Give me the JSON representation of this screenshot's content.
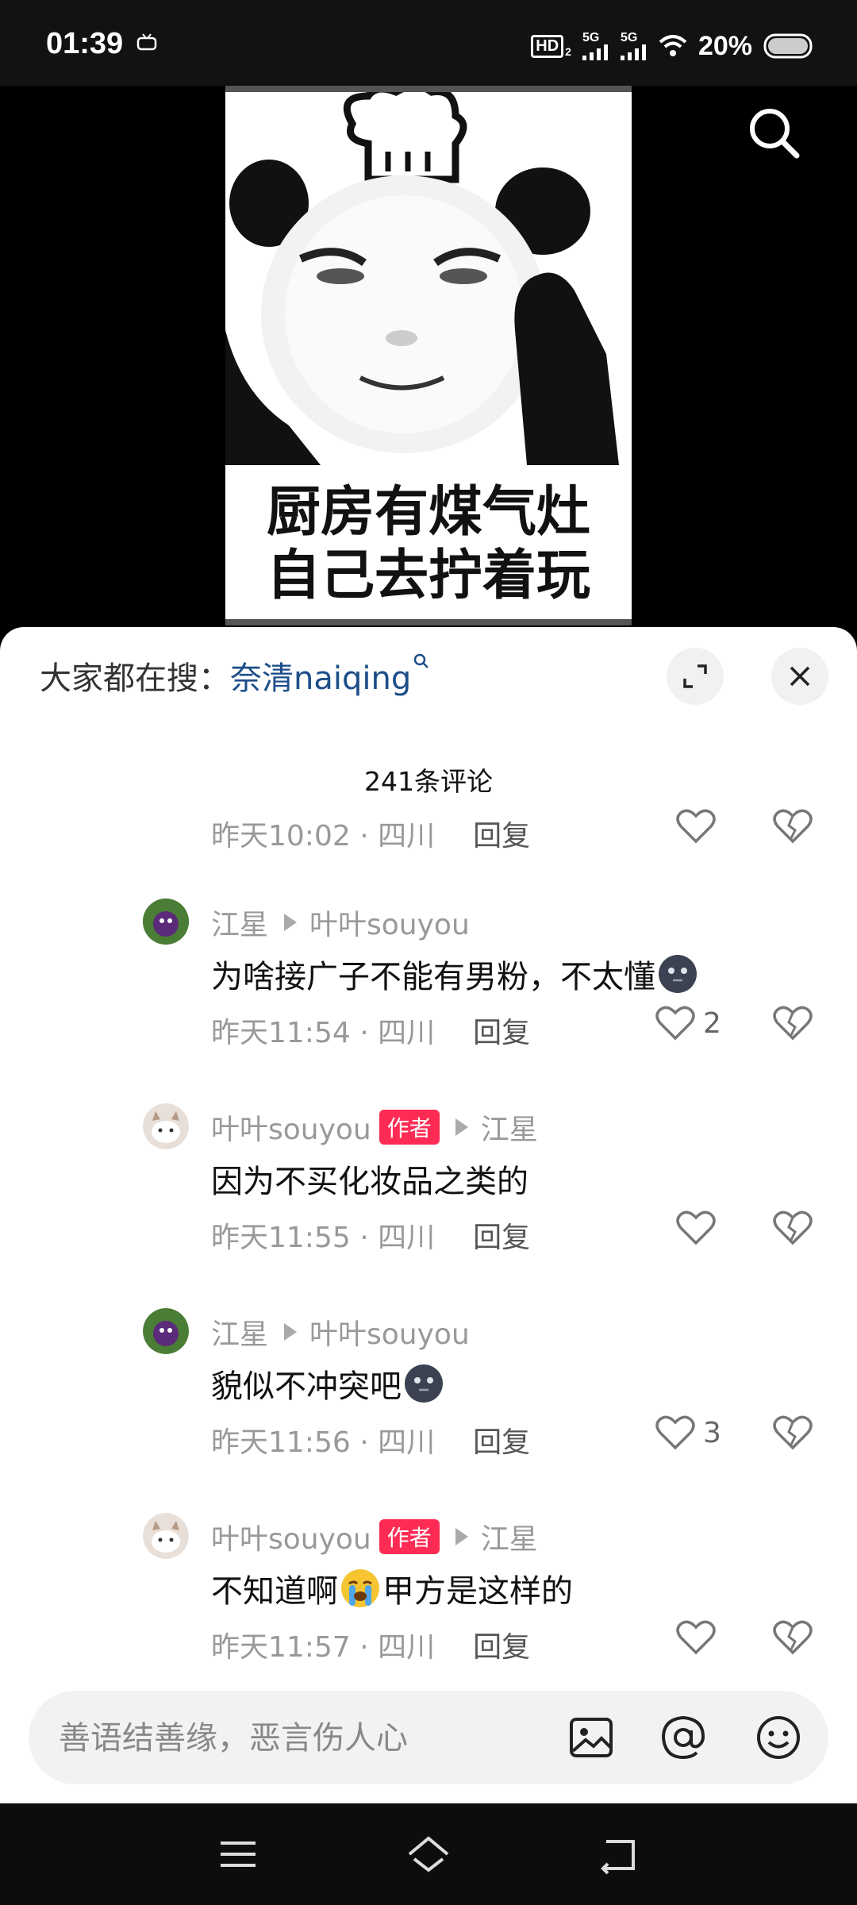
{
  "status_bar": {
    "time": "01:39",
    "hd_label": "HD",
    "hd_sub": "2",
    "sim1": "5G",
    "sim2": "5G",
    "battery": "20%"
  },
  "video": {
    "caption_line1": "厨房有煤气灶",
    "caption_line2": "自己去拧着玩"
  },
  "comments_panel": {
    "search_prefix": "大家都在搜：",
    "search_keyword": "奈清naiqing",
    "count_label": "241条评论",
    "comments": [
      {
        "kind": "partial",
        "time": "昨天10:02 · 四川",
        "reply_label": "回复",
        "likes": ""
      },
      {
        "author": "江星",
        "is_author": false,
        "reply_to": "叶叶souyou",
        "text": "为啥接广子不能有男粉，不太懂",
        "emoji": "dark-face",
        "time": "昨天11:54 · 四川",
        "reply_label": "回复",
        "likes": "2"
      },
      {
        "author": "叶叶souyou",
        "is_author": true,
        "badge": "作者",
        "reply_to": "江星",
        "text": "因为不买化妆品之类的",
        "time": "昨天11:55 · 四川",
        "reply_label": "回复",
        "likes": ""
      },
      {
        "author": "江星",
        "is_author": false,
        "reply_to": "叶叶souyou",
        "text": "貌似不冲突吧",
        "emoji": "dark-face",
        "time": "昨天11:56 · 四川",
        "reply_label": "回复",
        "likes": "3"
      },
      {
        "author": "叶叶souyou",
        "is_author": true,
        "badge": "作者",
        "reply_to": "江星",
        "text_before": "不知道啊",
        "emoji": "crying-face",
        "text_after": "甲方是这样的",
        "time": "昨天11:57 · 四川",
        "reply_label": "回复",
        "likes": ""
      }
    ]
  },
  "input": {
    "placeholder": "善语结善缘，恶言伤人心"
  },
  "colors": {
    "author_badge": "#fe2c55",
    "keyword": "#1d4e89"
  }
}
